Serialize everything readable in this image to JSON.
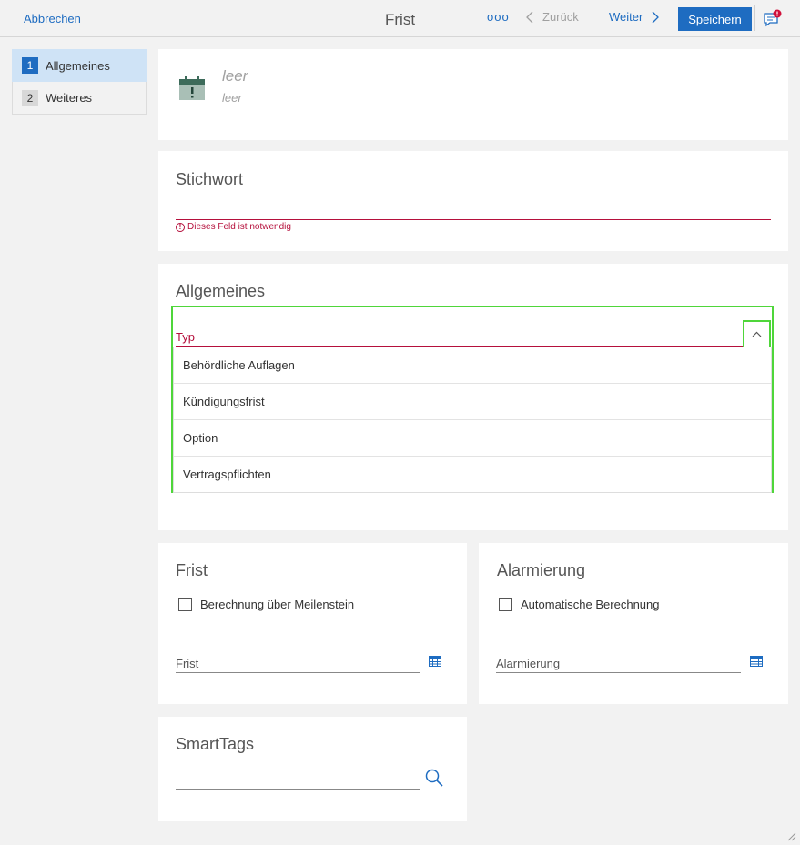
{
  "toolbar": {
    "cancel_label": "Abbrechen",
    "title": "Frist",
    "more_label": "ooo",
    "back_label": "Zurück",
    "next_label": "Weiter",
    "save_label": "Speichern"
  },
  "nav": {
    "items": [
      {
        "num": "1",
        "label": "Allgemeines",
        "active": true
      },
      {
        "num": "2",
        "label": "Weiteres",
        "active": false
      }
    ]
  },
  "header": {
    "title": "leer",
    "subtitle": "leer"
  },
  "stichwort": {
    "title": "Stichwort",
    "error": "Dieses Feld ist notwendig"
  },
  "allgemeines": {
    "title": "Allgemeines",
    "typ_label": "Typ",
    "options": [
      "Behördliche Auflagen",
      "Kündigungsfrist",
      "Option",
      "Vertragspflichten"
    ]
  },
  "frist": {
    "title": "Frist",
    "checkbox_label": "Berechnung über Meilenstein",
    "field_label": "Frist"
  },
  "alarmierung": {
    "title": "Alarmierung",
    "checkbox_label": "Automatische Berechnung",
    "field_label": "Alarmierung"
  },
  "smarttags": {
    "title": "SmartTags"
  },
  "colors": {
    "accent": "#1e6cc1",
    "error": "#b5103c",
    "highlight": "#4fd63a"
  }
}
